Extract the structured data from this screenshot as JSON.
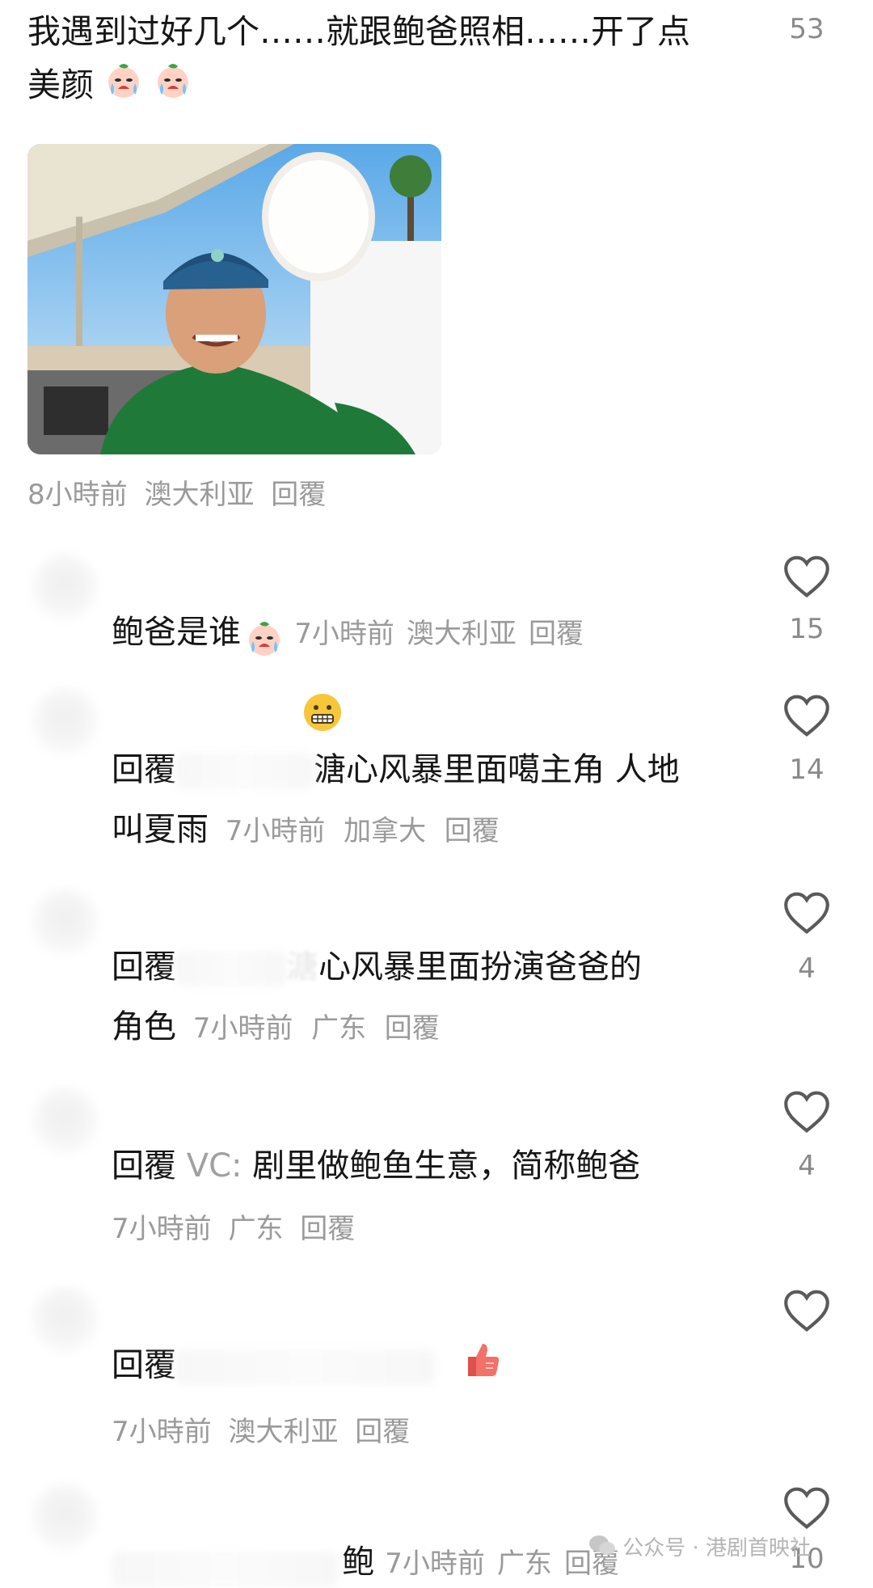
{
  "main_comment": {
    "text": "我遇到过好几个……就跟鲍爸照相……开了点美颜",
    "likes": "53",
    "meta_time": "8小時前",
    "meta_location": "澳大利亚",
    "meta_reply": "回覆"
  },
  "replies": [
    {
      "text": "鲍爸是谁",
      "time": "7小時前",
      "location": "澳大利亚",
      "reply": "回覆",
      "likes": "15"
    },
    {
      "prefix": "回覆",
      "text_line1": "溏心风暴里面噶主角 人地",
      "text_line2": "叫夏雨",
      "time": "7小時前",
      "location": "加拿大",
      "reply": "回覆",
      "likes": "14"
    },
    {
      "prefix": "回覆",
      "text_line1": "心风暴里面扮演爸爸的",
      "text_line2": "角色",
      "blur_fragment": "溏",
      "time": "7小時前",
      "location": "广东",
      "reply": "回覆",
      "likes": "4"
    },
    {
      "prefix": "回覆",
      "user": "VC:",
      "text": "剧里做鲍鱼生意，简称鲍爸",
      "time": "7小時前",
      "location": "广东",
      "reply": "回覆",
      "likes": "4"
    },
    {
      "prefix": "回覆",
      "time": "7小時前",
      "location": "澳大利亚",
      "reply": "回覆",
      "likes": ""
    },
    {
      "text": "鲍",
      "time": "7小時前",
      "location": "广东",
      "reply": "回覆",
      "likes": "10"
    }
  ],
  "watermark": "公众号 · 港剧首映社",
  "colors": {
    "text": "#161616",
    "meta": "#9a9a9a",
    "heart_stroke": "#5a5a5a"
  }
}
